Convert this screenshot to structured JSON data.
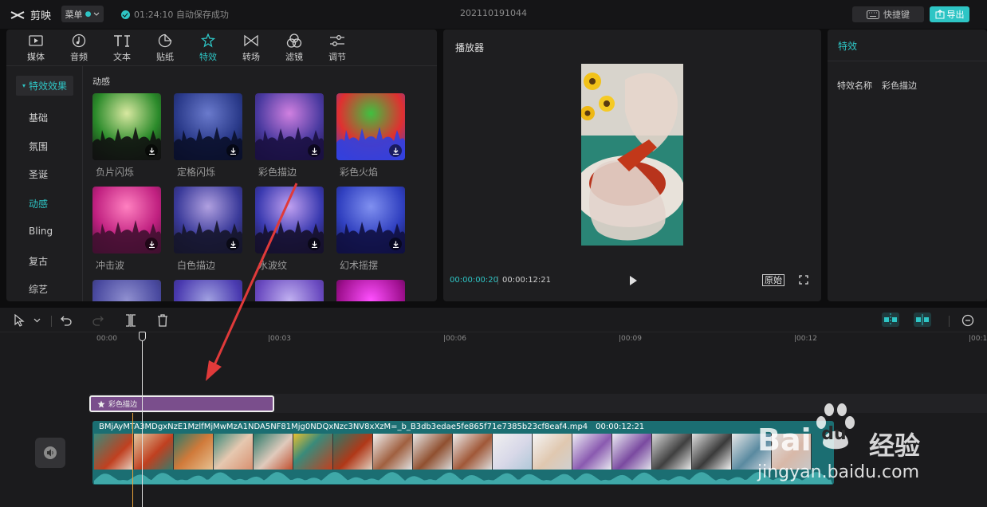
{
  "topbar": {
    "app_name": "剪映",
    "menu_label": "菜单",
    "save_status": "01:24:10 自动保存成功",
    "project_name": "202110191044",
    "shortcut_label": "快捷键",
    "export_label": "导出"
  },
  "tabs": [
    {
      "label": "媒体",
      "icon": "media-icon"
    },
    {
      "label": "音频",
      "icon": "audio-icon"
    },
    {
      "label": "文本",
      "icon": "text-icon"
    },
    {
      "label": "贴纸",
      "icon": "sticker-icon"
    },
    {
      "label": "特效",
      "icon": "effects-icon",
      "active": true
    },
    {
      "label": "转场",
      "icon": "transition-icon"
    },
    {
      "label": "滤镜",
      "icon": "filter-icon"
    },
    {
      "label": "调节",
      "icon": "adjust-icon"
    }
  ],
  "sidebar": {
    "category": "特效效果",
    "items": [
      "基础",
      "氛围",
      "圣诞",
      "动感",
      "Bling",
      "复古",
      "综艺"
    ],
    "active": "动感"
  },
  "section_title": "动感",
  "effects": [
    {
      "label": "负片闪烁",
      "colors": [
        "#2a8a2a",
        "#d8e8a0",
        "#111"
      ]
    },
    {
      "label": "定格闪烁",
      "colors": [
        "#2a3a8a",
        "#6a7acc",
        "#0a0f2a"
      ]
    },
    {
      "label": "彩色描边",
      "colors": [
        "#4a3aa0",
        "#d080e0",
        "#1a1040"
      ]
    },
    {
      "label": "彩色火焰",
      "colors": [
        "#e03030",
        "#40c040",
        "#3040e0"
      ]
    },
    {
      "label": "冲击波",
      "colors": [
        "#c02080",
        "#ff80c0",
        "#401030"
      ]
    },
    {
      "label": "白色描边",
      "colors": [
        "#3a3a9a",
        "#b0a0e0",
        "#15152a"
      ]
    },
    {
      "label": "水波纹",
      "colors": [
        "#3a3ab0",
        "#c0a0f0",
        "#15102a"
      ]
    },
    {
      "label": "幻术摇摆",
      "colors": [
        "#3040c0",
        "#8090f0",
        "#101040"
      ]
    },
    {
      "label": "",
      "colors": [
        "#4a4aa0",
        "#9090d0",
        "#202040"
      ]
    },
    {
      "label": "",
      "colors": [
        "#4a3ab0",
        "#a0a0e0",
        "#202050"
      ]
    },
    {
      "label": "",
      "colors": [
        "#6a4ac0",
        "#c0b0f0",
        "#302060"
      ]
    },
    {
      "label": "",
      "colors": [
        "#a01090",
        "#ff50ff",
        "#100010"
      ]
    }
  ],
  "player": {
    "title": "播放器",
    "current_time": "00:00:00:20",
    "total_time": "00:00:12:21",
    "original_label": "原始"
  },
  "properties": {
    "title": "特效",
    "name_label": "特效名称",
    "name_value": "彩色描边"
  },
  "timeline": {
    "ruler": [
      "00:00",
      "|00:03",
      "|00:06",
      "|00:09",
      "|00:12",
      "|00:1"
    ],
    "effect_clip_label": "彩色描边",
    "video_clip_name": "BMjAyMTA3MDgxNzE1MzlfMjMwMzA1NDA5NF81Mjg0NDQxNzc3NV8xXzM=_b_B3db3edae5fe865f71e7385b23cf8eaf4.mp4",
    "video_clip_duration": "00:00:12:21"
  },
  "watermark": {
    "brand": "Bai",
    "brand_paw": "du",
    "site_cn": "经验",
    "url": "jingyan.baidu.com"
  },
  "colors": {
    "accent": "#2ec5c5",
    "effect_clip": "#7a4e8c",
    "video_clip": "#1b6e72",
    "annotation": "#e03a3a"
  }
}
